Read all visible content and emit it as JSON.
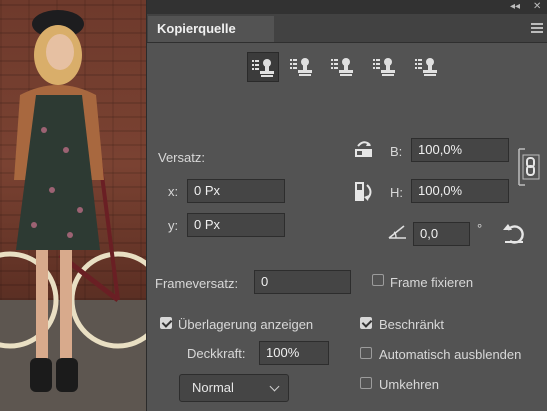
{
  "panel": {
    "title": "Kopierquelle",
    "collapse_glyph": "◂◂",
    "close_glyph": "✕",
    "menu_icon": "panel-menu-icon",
    "clone_sources": [
      "clone-source-1",
      "clone-source-2",
      "clone-source-3",
      "clone-source-4",
      "clone-source-5"
    ]
  },
  "offset": {
    "label": "Versatz:",
    "x_label": "x:",
    "x_value": "0 Px",
    "y_label": "y:",
    "y_value": "0 Px",
    "w_label": "B:",
    "w_value": "100,0%",
    "h_label": "H:",
    "h_value": "100,0%",
    "angle_value": "0,0",
    "degree_symbol": "°"
  },
  "frame": {
    "offset_label": "Frameversatz:",
    "offset_value": "0",
    "lock_frame_label": "Frame fixieren",
    "lock_frame_checked": false
  },
  "overlay": {
    "show_label": "Überlagerung anzeigen",
    "show_checked": true,
    "opacity_label": "Deckkraft:",
    "opacity_value": "100%",
    "blend_mode": "Normal",
    "clipped_label": "Beschränkt",
    "clipped_checked": true,
    "auto_hide_label": "Automatisch ausblenden",
    "auto_hide_checked": false,
    "invert_label": "Umkehren",
    "invert_checked": false
  },
  "colors": {
    "panel_bg": "#535353",
    "field_bg": "#454545",
    "text": "#d8d8d8"
  }
}
